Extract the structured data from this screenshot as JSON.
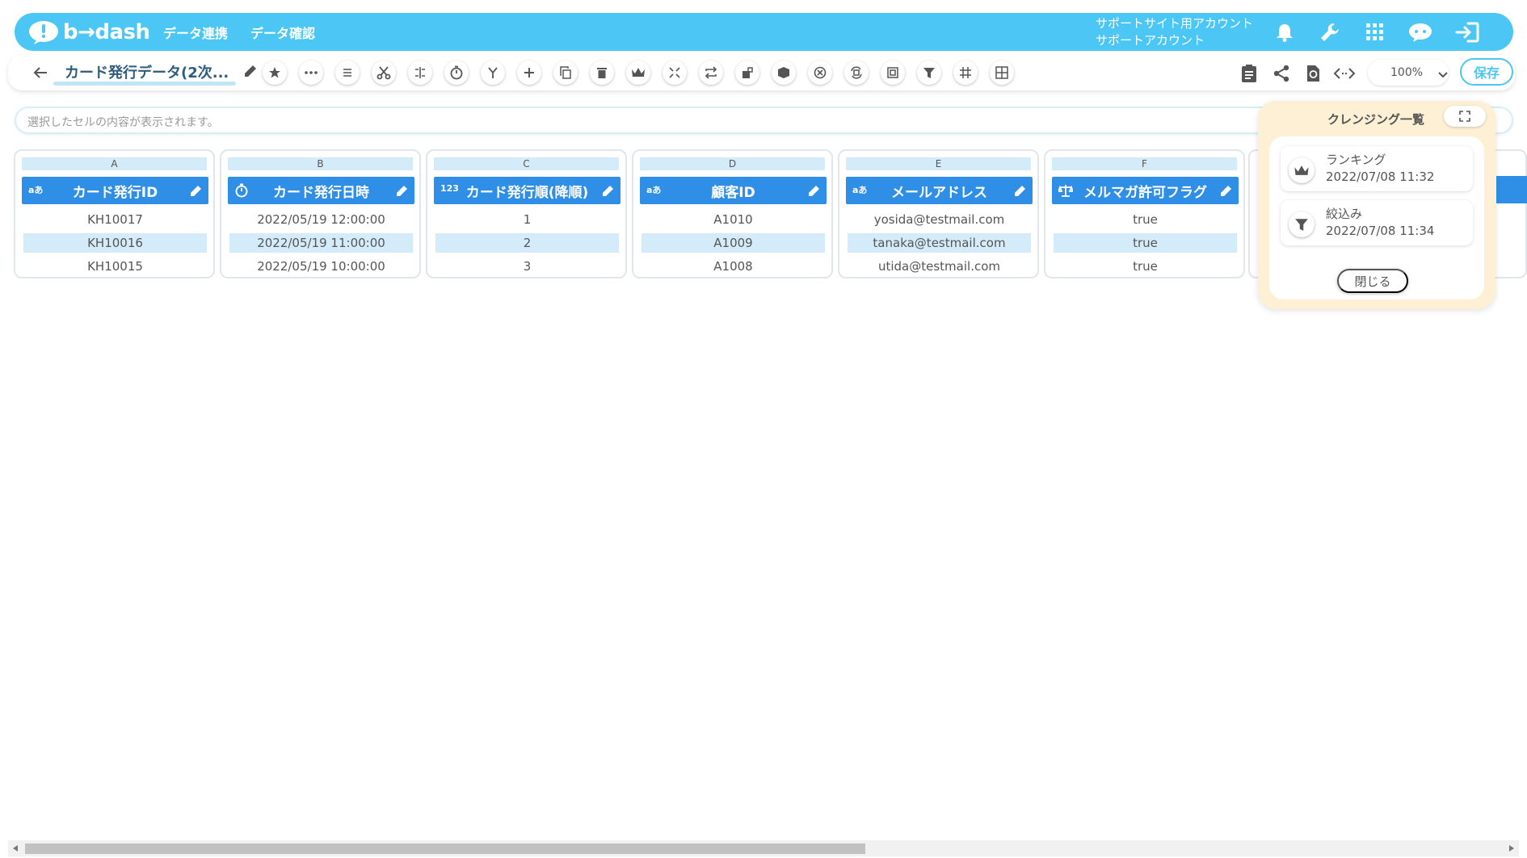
{
  "header": {
    "logo_text": "b→dash",
    "nav": [
      "データ連携",
      "データ確認"
    ],
    "account_line1": "サポートサイト用アカウント",
    "account_line2": "サポートアカウント"
  },
  "toolbar": {
    "data_title": "カード発行データ(2次...",
    "zoom": "100%",
    "save_label": "保存"
  },
  "cell_bar": {
    "placeholder": "選択したセルの内容が表示されます。"
  },
  "table": {
    "columns": [
      {
        "letter": "A",
        "type_icon": "aあ",
        "name": "カード発行ID",
        "cells": [
          "KH10017",
          "KH10016",
          "KH10015"
        ]
      },
      {
        "letter": "B",
        "type_icon": "clock",
        "name": "カード発行日時",
        "cells": [
          "2022/05/19 12:00:00",
          "2022/05/19 11:00:00",
          "2022/05/19 10:00:00"
        ]
      },
      {
        "letter": "C",
        "type_icon": "123",
        "name": "カード発行順(降順)",
        "cells": [
          "1",
          "2",
          "3"
        ]
      },
      {
        "letter": "D",
        "type_icon": "aあ",
        "name": "顧客ID",
        "cells": [
          "A1010",
          "A1009",
          "A1008"
        ]
      },
      {
        "letter": "E",
        "type_icon": "aあ",
        "name": "メールアドレス",
        "cells": [
          "yosida@testmail.com",
          "tanaka@testmail.com",
          "utida@testmail.com"
        ]
      },
      {
        "letter": "F",
        "type_icon": "scale",
        "name": "メルマガ許可フラグ",
        "cells": [
          "true",
          "true",
          "true"
        ]
      }
    ]
  },
  "panel": {
    "title": "クレンジング一覧",
    "items": [
      {
        "name": "ランキング",
        "time": "2022/07/08 11:32",
        "icon": "crown-icon"
      },
      {
        "name": "絞込み",
        "time": "2022/07/08 11:34",
        "icon": "filter-icon"
      }
    ],
    "close_label": "閉じる"
  },
  "colors": {
    "brand": "#4cc6f5",
    "column_header": "#2f8ee6",
    "row_alt": "#d4ebfa",
    "panel_bg": "#fdf0d5"
  }
}
